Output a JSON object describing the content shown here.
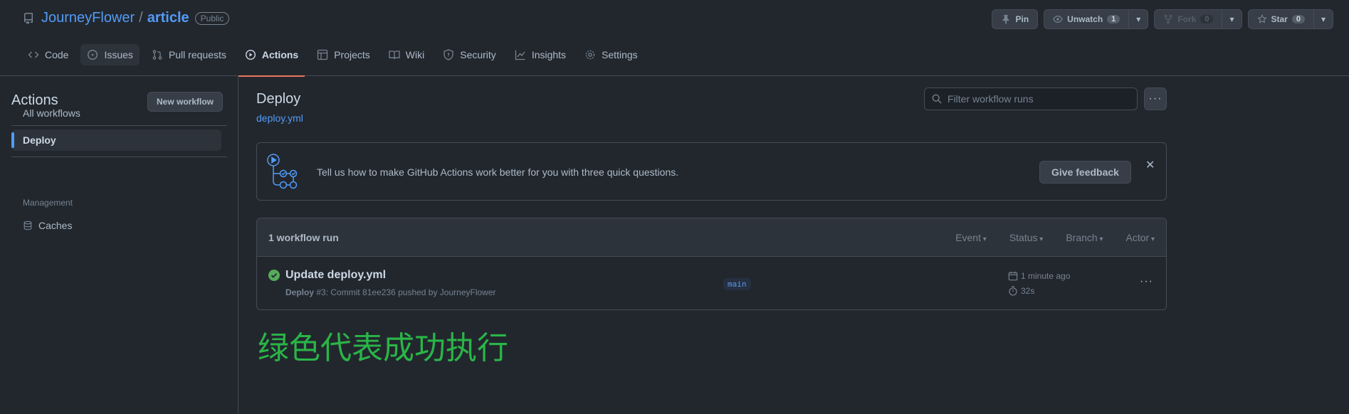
{
  "repo": {
    "owner": "JourneyFlower",
    "separator": "/",
    "name": "article",
    "visibility": "Public"
  },
  "repo_actions": {
    "pin": "Pin",
    "unwatch": "Unwatch",
    "watch_count": "1",
    "fork": "Fork",
    "fork_count": "0",
    "star": "Star",
    "star_count": "0"
  },
  "tabs": [
    {
      "label": "Code",
      "icon": "code-icon"
    },
    {
      "label": "Issues",
      "icon": "issue-icon"
    },
    {
      "label": "Pull requests",
      "icon": "pull-request-icon"
    },
    {
      "label": "Actions",
      "icon": "play-icon"
    },
    {
      "label": "Projects",
      "icon": "table-icon"
    },
    {
      "label": "Wiki",
      "icon": "book-icon"
    },
    {
      "label": "Security",
      "icon": "shield-icon"
    },
    {
      "label": "Insights",
      "icon": "graph-icon"
    },
    {
      "label": "Settings",
      "icon": "gear-icon"
    }
  ],
  "sidebar": {
    "title": "Actions",
    "new_workflow": "New workflow",
    "all_workflows": "All workflows",
    "selected_workflow": "Deploy",
    "management_heading": "Management",
    "caches": "Caches"
  },
  "workflow": {
    "title": "Deploy",
    "file": "deploy.yml",
    "filter_placeholder": "Filter workflow runs",
    "more": "···"
  },
  "banner": {
    "text": "Tell us how to make GitHub Actions work better for you with three quick questions.",
    "feedback_button": "Give feedback",
    "close": "✕"
  },
  "runs": {
    "count": "1 workflow run",
    "filters": [
      "Event",
      "Status",
      "Branch",
      "Actor"
    ],
    "items": [
      {
        "title": "Update deploy.yml",
        "workflow": "Deploy",
        "meta": "#3: Commit 81ee236 pushed by JourneyFlower",
        "branch": "main",
        "time": "1 minute ago",
        "duration": "32s",
        "more": "···"
      }
    ]
  },
  "note": "绿色代表成功执行",
  "colors": {
    "background": "#22272e",
    "link": "#539bf5",
    "active_tab_underline": "#ec775c",
    "success": "#57ab5a",
    "note": "#2ab547"
  }
}
